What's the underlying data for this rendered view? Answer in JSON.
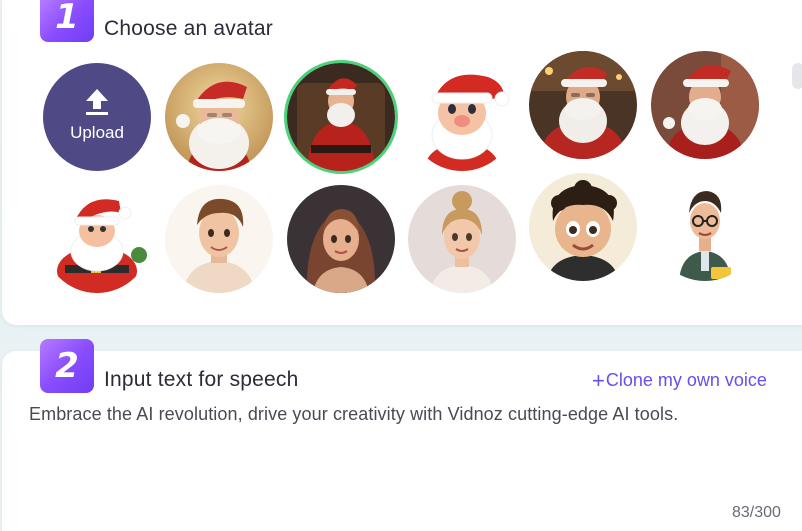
{
  "avatar_section": {
    "step_number": "1",
    "title": "Choose an avatar",
    "upload_label": "Upload",
    "avatars_row1": [
      "santa-photo-1",
      "santa-photo-2-selected",
      "santa-cartoon-1",
      "santa-photo-3",
      "santa-photo-4"
    ],
    "avatars_row2": [
      "santa-cartoon-2",
      "young-man-cartoon",
      "woman-long-hair-cartoon",
      "woman-bun-cartoon",
      "boy-curly-hair-cartoon",
      "man-glasses-cartoon"
    ]
  },
  "speech_section": {
    "step_number": "2",
    "title": "Input text for speech",
    "clone_plus": "+",
    "clone_label": "Clone my own voice",
    "text_value": "Embrace the AI revolution, drive your creativity with Vidnoz cutting-edge AI tools.",
    "counter": "83/300"
  },
  "colors": {
    "accent": "#6c4cf0",
    "badge": "#8a4dff",
    "upload_bg": "#4f4a86",
    "selected_ring": "#4cd37a"
  }
}
